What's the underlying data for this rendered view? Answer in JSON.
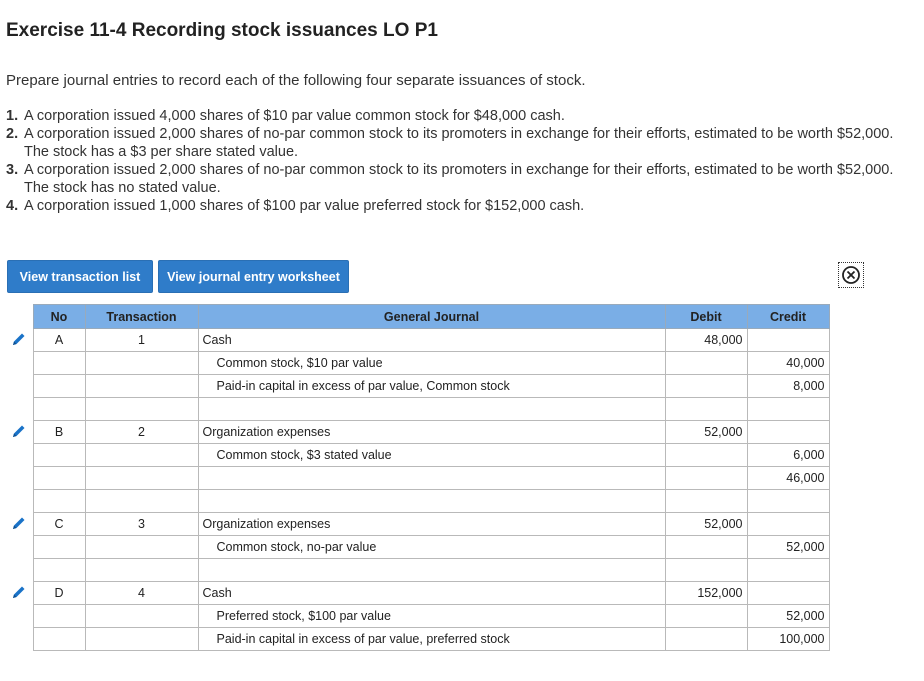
{
  "title": "Exercise 11-4 Recording stock issuances LO P1",
  "intro": "Prepare journal entries to record each of the following four separate issuances of stock.",
  "items": [
    {
      "num": "1.",
      "text": "A corporation issued 4,000 shares of $10 par value common stock for $48,000 cash."
    },
    {
      "num": "2.",
      "text": "A corporation issued 2,000 shares of no-par common stock to its promoters in exchange for their efforts, estimated to be worth $52,000. The stock has a $3 per share stated value."
    },
    {
      "num": "3.",
      "text": "A corporation issued 2,000 shares of no-par common stock to its promoters in exchange for their efforts, estimated to be worth $52,000. The stock has no stated value."
    },
    {
      "num": "4.",
      "text": "A corporation issued 1,000 shares of $100 par value preferred stock for $152,000 cash."
    }
  ],
  "buttons": {
    "transaction_list": "View transaction list",
    "journal_worksheet": "View journal entry worksheet"
  },
  "table": {
    "headers": {
      "no": "No",
      "transaction": "Transaction",
      "journal": "General Journal",
      "debit": "Debit",
      "credit": "Credit"
    },
    "rows": [
      {
        "no": "A",
        "txn": "1",
        "account": "Cash",
        "credit_side": false,
        "debit": "48,000",
        "credit": "",
        "edit": true
      },
      {
        "no": "",
        "txn": "",
        "account": "Common stock, $10 par value",
        "credit_side": true,
        "debit": "",
        "credit": "40,000",
        "edit": false
      },
      {
        "no": "",
        "txn": "",
        "account": "Paid-in capital in excess of par value, Common stock",
        "credit_side": true,
        "debit": "",
        "credit": "8,000",
        "edit": false
      },
      {
        "no": "",
        "txn": "",
        "account": "",
        "credit_side": false,
        "debit": "",
        "credit": "",
        "edit": false
      },
      {
        "no": "B",
        "txn": "2",
        "account": "Organization expenses",
        "credit_side": false,
        "debit": "52,000",
        "credit": "",
        "edit": true
      },
      {
        "no": "",
        "txn": "",
        "account": "Common stock, $3 stated value",
        "credit_side": true,
        "debit": "",
        "credit": "6,000",
        "edit": false
      },
      {
        "no": "",
        "txn": "",
        "account": "",
        "credit_side": false,
        "debit": "",
        "credit": "46,000",
        "edit": false
      },
      {
        "no": "",
        "txn": "",
        "account": "",
        "credit_side": false,
        "debit": "",
        "credit": "",
        "edit": false
      },
      {
        "no": "C",
        "txn": "3",
        "account": "Organization expenses",
        "credit_side": false,
        "debit": "52,000",
        "credit": "",
        "edit": true
      },
      {
        "no": "",
        "txn": "",
        "account": "Common stock, no-par value",
        "credit_side": true,
        "debit": "",
        "credit": "52,000",
        "edit": false
      },
      {
        "no": "",
        "txn": "",
        "account": "",
        "credit_side": false,
        "debit": "",
        "credit": "",
        "edit": false
      },
      {
        "no": "D",
        "txn": "4",
        "account": "Cash",
        "credit_side": false,
        "debit": "152,000",
        "credit": "",
        "edit": true
      },
      {
        "no": "",
        "txn": "",
        "account": "Preferred stock, $100 par value",
        "credit_side": true,
        "debit": "",
        "credit": "52,000",
        "edit": false
      },
      {
        "no": "",
        "txn": "",
        "account": "Paid-in capital in excess of par value, preferred stock",
        "credit_side": true,
        "debit": "",
        "credit": "100,000",
        "edit": false
      }
    ]
  },
  "colors": {
    "header_blue": "#7aaee6",
    "button_blue": "#2f7cc9",
    "pencil_blue": "#1a73c8"
  },
  "icons": {
    "edit": "pencil-icon",
    "close": "close-circle-icon"
  }
}
